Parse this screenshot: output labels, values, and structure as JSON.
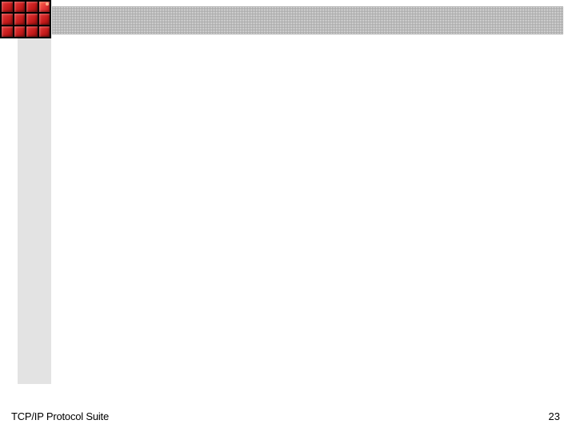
{
  "footer": {
    "title": "TCP/IP Protocol Suite",
    "page_number": "23"
  }
}
